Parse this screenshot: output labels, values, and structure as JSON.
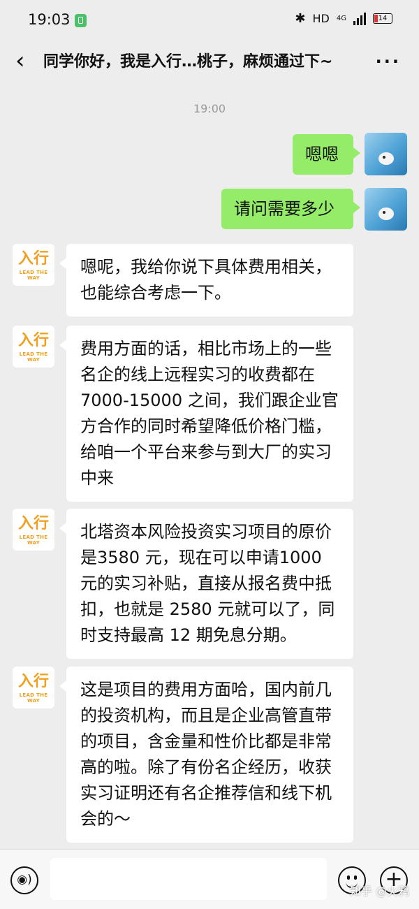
{
  "status_bar": {
    "time": "19:03",
    "bluetooth_icon": "bluetooth-icon",
    "network": "HD",
    "network_type": "4G",
    "battery": "14"
  },
  "header": {
    "title": "同学你好，我是入行…桃子，麻烦通过下~",
    "back_icon": "chevron-left-icon",
    "more_icon": "more-icon"
  },
  "timestamp": "19:00",
  "company_avatar": {
    "logo_text": "入行",
    "tagline": "LEAD THE WAY",
    "color": "#f0a020"
  },
  "messages": [
    {
      "sender": "me",
      "text": "嗯嗯"
    },
    {
      "sender": "me",
      "text": "请问需要多少"
    },
    {
      "sender": "company",
      "text": "嗯呢，我给你说下具体费用相关，也能综合考虑一下。"
    },
    {
      "sender": "company",
      "text": "费用方面的话，相比市场上的一些名企的线上远程实习的收费都在7000-15000 之间，我们跟企业官方合作的同时希望降低价格门槛，给咱一个平台来参与到大厂的实习中来"
    },
    {
      "sender": "company",
      "text": "北塔资本风险投资实习项目的原价是3580 元，现在可以申请1000 元的实习补贴，直接从报名费中抵扣，也就是 2580 元就可以了，同时支持最高 12 期免息分期。"
    },
    {
      "sender": "company",
      "text": "这是项目的费用方面哈，国内前几的投资机构，而且是企业高管直带的项目，含金量和性价比都是非常高的啦。除了有份名企经历，收获实习证明还有名企推荐信和线下机会的～"
    }
  ],
  "input_bar": {
    "voice_icon": "voice-icon",
    "text_value": "",
    "emoji_icon": "emoji-icon",
    "plus_icon": "plus-icon"
  },
  "watermark": "知乎 @火鸦",
  "colors": {
    "my_bubble": "#95ec69",
    "their_bubble": "#ffffff",
    "background": "#ededed"
  }
}
